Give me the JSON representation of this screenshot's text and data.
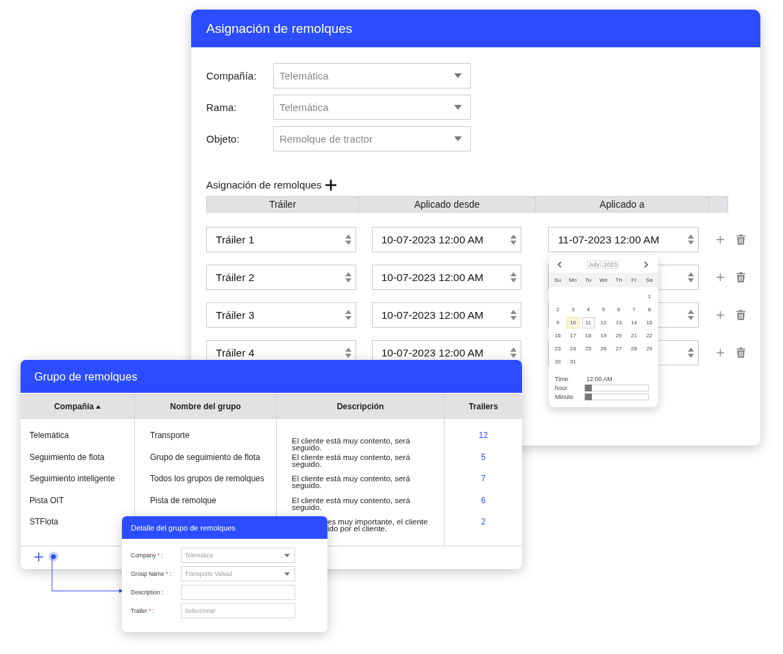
{
  "main_window": {
    "title": "Asignación de remolques",
    "filters": [
      {
        "label": "Compañía:",
        "value": "Telemática"
      },
      {
        "label": "Rama:",
        "value": "Telemática"
      },
      {
        "label": "Objeto:",
        "value": "Remolque de tractor"
      }
    ],
    "section_title": "Asignación de remolques",
    "columns": [
      "Tráiler",
      "Aplicado desde",
      "Aplicado a"
    ],
    "rows": [
      {
        "trailer": "Tráiler 1",
        "applied_from": "10-07-2023 12:00 AM",
        "applied_to": "11-07-2023 12:00 AM"
      },
      {
        "trailer": "Tráiler 2",
        "applied_from": "10-07-2023 12:00 AM"
      },
      {
        "trailer": "Tráiler 3",
        "applied_from": "10-07-2023 12:00 AM"
      },
      {
        "trailer": "Tráiler 4",
        "applied_from": "10-07-2023 12:00 AM"
      }
    ]
  },
  "date_picker": {
    "month": "July",
    "year": "2023",
    "weekdays": [
      "Su",
      "Mo",
      "Tu",
      "We",
      "Th",
      "Fr",
      "Sa"
    ],
    "weeks": [
      {
        "kind": "end",
        "days": [
          {
            "label": "1",
            "today": false,
            "selected": false
          }
        ]
      },
      {
        "kind": "full",
        "days": [
          {
            "label": "2",
            "today": false,
            "selected": false
          },
          {
            "label": "3",
            "today": false,
            "selected": false
          },
          {
            "label": "4",
            "today": false,
            "selected": false
          },
          {
            "label": "5",
            "today": false,
            "selected": false
          },
          {
            "label": "6",
            "today": false,
            "selected": false
          },
          {
            "label": "7",
            "today": false,
            "selected": false
          },
          {
            "label": "8",
            "today": false,
            "selected": false
          }
        ]
      },
      {
        "kind": "full",
        "days": [
          {
            "label": "9",
            "today": false,
            "selected": false
          },
          {
            "label": "10",
            "today": true,
            "selected": false
          },
          {
            "label": "11",
            "today": false,
            "selected": true
          },
          {
            "label": "12",
            "today": false,
            "selected": false
          },
          {
            "label": "13",
            "today": false,
            "selected": false
          },
          {
            "label": "14",
            "today": false,
            "selected": false
          },
          {
            "label": "15",
            "today": false,
            "selected": false
          }
        ]
      },
      {
        "kind": "full",
        "days": [
          {
            "label": "16",
            "today": false,
            "selected": false
          },
          {
            "label": "17",
            "today": false,
            "selected": false
          },
          {
            "label": "18",
            "today": false,
            "selected": false
          },
          {
            "label": "19",
            "today": false,
            "selected": false
          },
          {
            "label": "20",
            "today": false,
            "selected": false
          },
          {
            "label": "21",
            "today": false,
            "selected": false
          },
          {
            "label": "22",
            "today": false,
            "selected": false
          }
        ]
      },
      {
        "kind": "full",
        "days": [
          {
            "label": "23",
            "today": false,
            "selected": false
          },
          {
            "label": "24",
            "today": false,
            "selected": false
          },
          {
            "label": "25",
            "today": false,
            "selected": false
          },
          {
            "label": "26",
            "today": false,
            "selected": false
          },
          {
            "label": "27",
            "today": false,
            "selected": false
          },
          {
            "label": "28",
            "today": false,
            "selected": false
          },
          {
            "label": "29",
            "today": false,
            "selected": false
          }
        ]
      },
      {
        "kind": "start",
        "days": [
          {
            "label": "30",
            "today": false,
            "selected": false
          },
          {
            "label": "31",
            "today": false,
            "selected": false
          }
        ]
      }
    ],
    "time_label": "Time",
    "time_value": "12:00 AM",
    "sliders": [
      {
        "label": "hour",
        "level": 0
      },
      {
        "label": "Minute",
        "level": 0
      }
    ]
  },
  "group_window": {
    "title": "Grupo de remolques",
    "columns": [
      {
        "label": "Compañía",
        "sorted": true
      },
      {
        "label": "Nombre del grupo",
        "sorted": false
      },
      {
        "label": "Descripción",
        "sorted": false
      },
      {
        "label": "Trailers",
        "sorted": false
      }
    ],
    "rows": [
      {
        "kind": "full",
        "company": "Telemática",
        "group": "Transporte",
        "description": "El cliente está muy contento, será seguido.",
        "trailers": "12"
      },
      {
        "kind": "full",
        "company": "Seguimiento de flota",
        "group": "Grupo de seguimiento de flota",
        "description": "El cliente está muy contento, será seguido.",
        "trailers": "5"
      },
      {
        "kind": "full",
        "company": "Seguimiento inteligente",
        "group": "Todos los grupos de remolques",
        "description": "El cliente está muy contento, será seguido.",
        "trailers": "7"
      },
      {
        "kind": "full",
        "company": "Pista OIT",
        "group": "Pista de remolque",
        "description": "El cliente está muy contento, será seguido.",
        "trailers": "6"
      },
      {
        "kind": "covered",
        "company": "STFlota",
        "description": "es muy importante, el cliente ido por el cliente.",
        "trailers": "2"
      }
    ]
  },
  "detail_dialog": {
    "title": "Detalle del grupo de remolques",
    "fields": [
      {
        "kind": "select",
        "label": "Company",
        "required_mark": "*",
        "colon": ":",
        "value": "Telemática"
      },
      {
        "kind": "select",
        "label": "Group Name",
        "required_mark": "*",
        "colon": ":",
        "value": "Transporte Valsad"
      },
      {
        "kind": "text",
        "label": "Description",
        "colon": ":"
      },
      {
        "kind": "text",
        "label": "Trailer",
        "required_mark": "*",
        "colon": ":",
        "placeholder": "Seleccionar"
      }
    ]
  }
}
